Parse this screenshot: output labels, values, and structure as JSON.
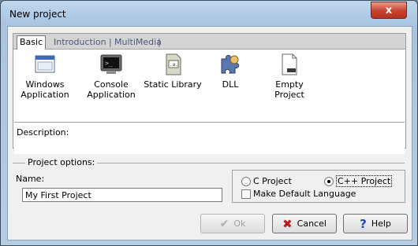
{
  "window": {
    "title": "New project",
    "close_label": "x"
  },
  "tabs": [
    {
      "label": "Basic"
    },
    {
      "label": "Introduction"
    },
    {
      "label": "MultiMedia"
    }
  ],
  "templates": [
    {
      "line1": "Windows",
      "line2": "Application",
      "icon": "windows-app-icon"
    },
    {
      "line1": "Console",
      "line2": "Application",
      "icon": "console-icon"
    },
    {
      "line1": "Static Library",
      "line2": "",
      "icon": "static-library-icon"
    },
    {
      "line1": "DLL",
      "line2": "",
      "icon": "dll-puzzle-icon"
    },
    {
      "line1": "Empty Project",
      "line2": "",
      "icon": "empty-project-icon"
    }
  ],
  "description_label": "Description:",
  "project_options": {
    "group_label": "Project options:",
    "name_label": "Name:",
    "name_value": "My First Project",
    "c_project_label": "C Project",
    "cpp_project_label": "C++ Project",
    "selected_language": "C++ Project",
    "default_language_label": "Make Default Language",
    "default_language_checked": false
  },
  "buttons": {
    "ok_label": "Ok",
    "cancel_label": "Cancel",
    "help_label": "Help"
  },
  "colors": {
    "title_bar": "#b6cde4",
    "close": "#c8402e",
    "cancel_x": "#c01818",
    "help_q": "#1a46c8"
  }
}
